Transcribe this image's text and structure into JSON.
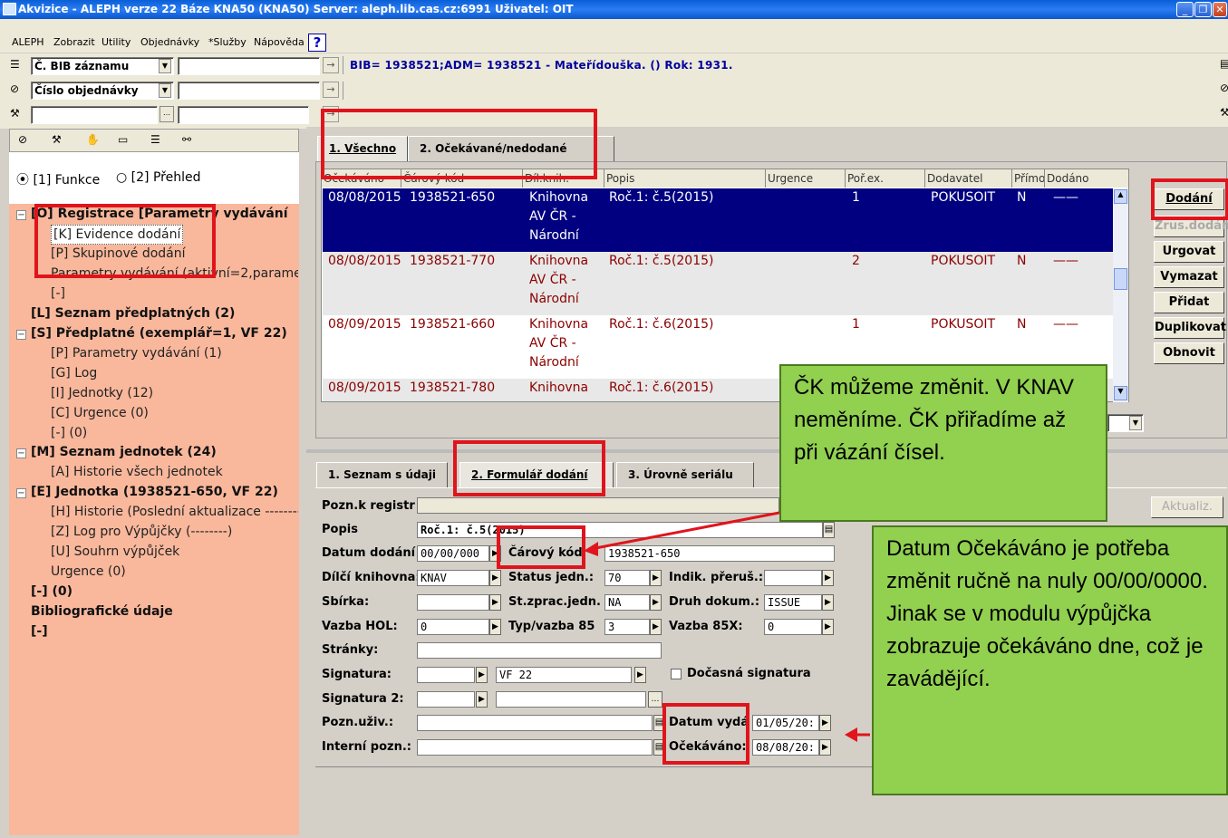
{
  "window": {
    "title": "Akvizice - ALEPH verze 22  Báze KNA50 (KNA50)  Server: aleph.lib.cas.cz:6991  Uživatel: OIT"
  },
  "menu": [
    "ALEPH",
    "Zobrazit",
    "Utility",
    "Objednávky",
    "*Služby",
    "Nápověda"
  ],
  "help": "?",
  "search": {
    "field1": "Č. BIB záznamu",
    "field2": "Číslo objednávky"
  },
  "bib_line": "BIB= 1938521;ADM= 1938521 - Mateřídouška. () Rok: 1931.",
  "left": {
    "radio1": "[1] Funkce",
    "radio2": "[2] Přehled",
    "tree": [
      "[O] Registrace [Parametry vydávání",
      "[K] Evidence dodání",
      "[P] Skupinové dodání",
      "Parametry vydávání (aktivní=2,parame",
      "[-]",
      "[L] Seznam předplatných (2)",
      "[S] Předplatné (exemplář=1, VF 22)",
      "[P] Parametry vydávání (1)",
      "[G] Log",
      "[I] Jednotky (12)",
      "[C] Urgence (0)",
      "[-] (0)",
      "[M] Seznam jednotek (24)",
      "[A] Historie všech jednotek",
      "[E] Jednotka (1938521-650, VF 22)",
      "[H] Historie (Poslední aktualizace --------",
      "[Z] Log pro Výpůjčky (--------)",
      "[U] Souhrn výpůjček",
      "Urgence (0)",
      "[-] (0)",
      "Bibliografické údaje",
      "[-]"
    ]
  },
  "top_tabs": [
    "1. Všechno",
    "2. Očekávané/nedodané"
  ],
  "grid": {
    "headers": [
      "Očekáváno",
      "Čárový kód",
      "Díl.knih.",
      "Popis",
      "Urgence",
      "Poř.ex.",
      "Dodavatel",
      "Přímo",
      "Dodáno"
    ],
    "rows": [
      {
        "exp": "08/08/2015",
        "bar": "1938521-650",
        "lib": [
          "Knihovna",
          "AV ČR -",
          "Národní"
        ],
        "desc": "Roč.1: č.5(2015)",
        "ord": "1",
        "sup": "POKUSOIT",
        "dir": "N",
        "del": "——"
      },
      {
        "exp": "08/08/2015",
        "bar": "1938521-770",
        "lib": [
          "Knihovna",
          "AV ČR -",
          "Národní"
        ],
        "desc": "Roč.1: č.5(2015)",
        "ord": "2",
        "sup": "POKUSOIT",
        "dir": "N",
        "del": "——"
      },
      {
        "exp": "08/09/2015",
        "bar": "1938521-660",
        "lib": [
          "Knihovna",
          "AV ČR -",
          "Národní"
        ],
        "desc": "Roč.1: č.6(2015)",
        "ord": "1",
        "sup": "POKUSOIT",
        "dir": "N",
        "del": "——"
      },
      {
        "exp": "08/09/2015",
        "bar": "1938521-780",
        "lib": [
          "Knihovna"
        ],
        "desc": "Roč.1: č.6(2015)",
        "ord": "",
        "sup": "",
        "dir": "",
        "del": ""
      }
    ]
  },
  "buttons": [
    "Dodání",
    "Zrus.dodán",
    "Urgovat",
    "Vymazat",
    "Přidat",
    "Duplikovat",
    "Obnovit"
  ],
  "bottom_tabs": [
    "1. Seznam s údaji",
    "2. Formulář dodání",
    "3. Úrovně seriálu"
  ],
  "aktualiz": "Aktualiz.",
  "form": {
    "pozn_registr": "Pozn.k registr",
    "popis": "Popis",
    "popis_val": "Roč.1: č.5(2015)",
    "datum_dodani": "Datum dodání",
    "datum_dodani_val": "00/00/000",
    "carovy_kod": "Čárový kód",
    "carovy_kod_val": "1938521-650",
    "dilci": "Dílčí knihovna:",
    "dilci_val": "KNAV",
    "status": "Status jedn.:",
    "status_val": "70",
    "indik": "Indik. přeruš.:",
    "sbirka": "Sbírka:",
    "stzprac": "St.zprac.jedn.",
    "stzprac_val": "NA",
    "druh": "Druh dokum.:",
    "druh_val": "ISSUE",
    "vazba": "Vazba HOL:",
    "vazba_val": "0",
    "typ": "Typ/vazba 85",
    "typ_val": "3",
    "vazba85": "Vazba 85X:",
    "vazba85_val": "0",
    "stranky": "Stránky:",
    "signatura": "Signatura:",
    "signatura_val": "VF 22",
    "docasna": "Dočasná signatura",
    "signatura2": "Signatura 2:",
    "pozn_uziv": "Pozn.uživ.:",
    "interni": "Interní pozn.:",
    "datum_vyd": "Datum vydá",
    "datum_vyd_val": "01/05/20:",
    "ocekavano": "Očekáváno:",
    "ocekavano_val": "08/08/20:"
  },
  "notes": {
    "n1": "ČK můžeme změnit. V KNAV neměníme. ČK přiřadíme až při vázání čísel.",
    "n2": "Datum Očekáváno je potřeba změnit ručně na nuly 00/00/0000. Jinak se v modulu výpůjčka zobrazuje očekáváno dne, což je zavádějící."
  },
  "colors": {
    "selected_row": "#000080",
    "tree_bg": "#f9b89c",
    "note_bg": "#92d050",
    "highlight": "#e0141c"
  }
}
